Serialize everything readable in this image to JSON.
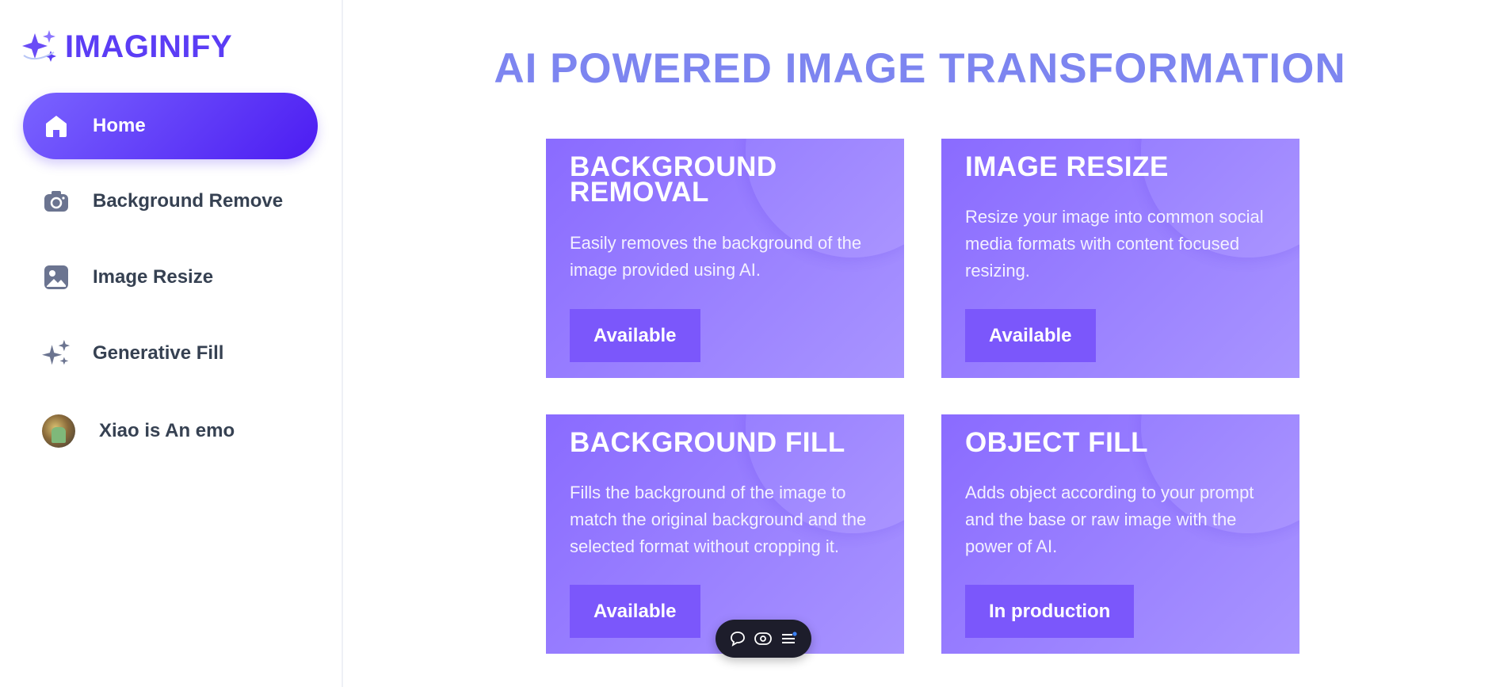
{
  "app": {
    "logo_text": "IMAGINIFY"
  },
  "sidebar": {
    "items": [
      {
        "label": "Home",
        "icon": "home-icon",
        "active": true
      },
      {
        "label": "Background Remove",
        "icon": "camera-icon",
        "active": false
      },
      {
        "label": "Image Resize",
        "icon": "image-icon",
        "active": false
      },
      {
        "label": "Generative Fill",
        "icon": "sparkles-icon",
        "active": false
      }
    ],
    "profile": {
      "name": "Xiao is An emo"
    }
  },
  "main": {
    "title": "AI POWERED IMAGE TRANSFORMATION",
    "cards": [
      {
        "title": "BACKGROUND REMOVAL",
        "description": "Easily removes the background of the image provided using AI.",
        "status": "Available"
      },
      {
        "title": "IMAGE RESIZE",
        "description": "Resize your image into common social media formats with content focused resizing.",
        "status": "Available"
      },
      {
        "title": "BACKGROUND FILL",
        "description": "Fills the background of the image to match the original background and the selected format without cropping it.",
        "status": "Available"
      },
      {
        "title": "OBJECT FILL",
        "description": "Adds object according to your prompt and the base or raw image with the power of AI.",
        "status": "In production"
      }
    ]
  },
  "toolbar": {
    "icons": [
      "comment-icon",
      "eye-icon",
      "menu-icon"
    ]
  },
  "colors": {
    "accent": "#5b3df5",
    "title": "#7d85f0",
    "card": "#8a6bff",
    "button": "#7b57fb"
  }
}
